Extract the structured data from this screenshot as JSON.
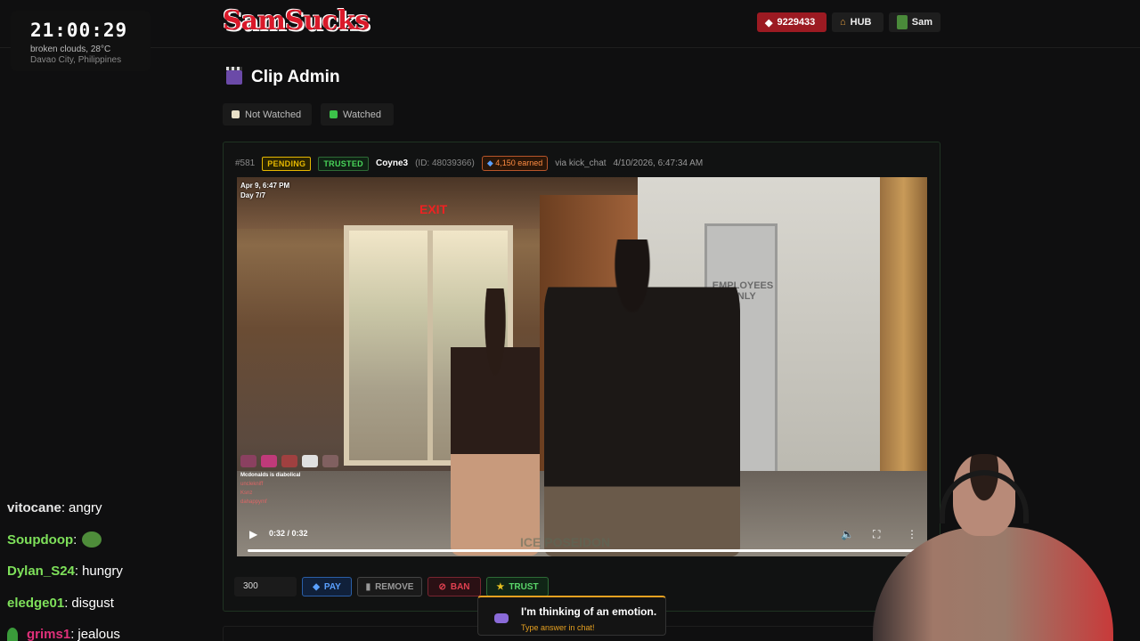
{
  "clock": {
    "time": "21:00:29",
    "weather": "broken clouds, 28°C",
    "location": "Davao City, Philippines"
  },
  "header": {
    "logo": "SamSucks",
    "coins": "9229433",
    "hub": "HUB",
    "user": "Sam",
    "colors": {
      "coins_bg": "#9c1a22"
    }
  },
  "page": {
    "title": "Clip Admin"
  },
  "filters": [
    {
      "label": "Not Watched",
      "icon": "notepad-icon"
    },
    {
      "label": "Watched",
      "icon": "checkbox-icon"
    }
  ],
  "clip": {
    "number": "#581",
    "status": "PENDING",
    "trust": "TRUSTED",
    "username": "Coyne3",
    "user_id": "(ID: 48039366)",
    "earned": "4,150 earned",
    "source": "via kick_chat",
    "timestamp": "4/10/2026, 6:47:34 AM",
    "video": {
      "date": "Apr 9, 6:47 PM",
      "day": "Day 7/7",
      "exit_sign": "EXIT",
      "door_sign": "EMPLOYEES ONLY",
      "chat_line": "Mcdonalds is diabolical",
      "chat_users": [
        "unclekniff",
        "Ksnz",
        "dahappymf"
      ],
      "watermark": "ICE POSEIDON",
      "time": "0:32 / 0:32",
      "progress": 1.0
    },
    "amount": "300",
    "actions": {
      "pay": "PAY",
      "remove": "REMOVE",
      "ban": "BAN",
      "trust": "TRUST"
    }
  },
  "chat": [
    {
      "user": "vitocane",
      "color": "#e6e6e6",
      "message": "angry"
    },
    {
      "user": "Soupdoop",
      "color": "#7ee05a",
      "message": "",
      "emote": "pepe-emote"
    },
    {
      "user": "Dylan_S24",
      "color": "#7ee05a",
      "message": "hungry"
    },
    {
      "user": "eledge01",
      "color": "#7ee05a",
      "message": "disgust"
    },
    {
      "user": "grims1",
      "color": "#e0307a",
      "message": "jealous",
      "badge": "plant-icon"
    }
  ],
  "toast": {
    "title": "I'm thinking of an emotion.",
    "subtitle": "Type answer in chat!"
  }
}
